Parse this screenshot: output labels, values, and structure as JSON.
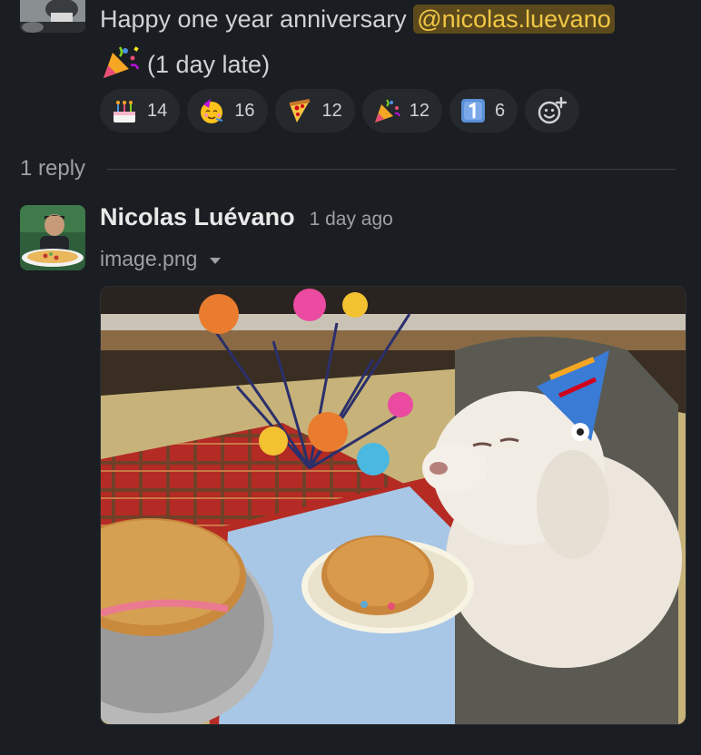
{
  "message": {
    "text_before": "Happy one year anniversary ",
    "mention": "@nicolas.luevano",
    "text_line2": "(1 day late)",
    "line2_emoji": "party-popper"
  },
  "reactions": [
    {
      "emoji": "birthday-cake",
      "count": "14"
    },
    {
      "emoji": "partying-face",
      "count": "16"
    },
    {
      "emoji": "pizza",
      "count": "12"
    },
    {
      "emoji": "party-popper",
      "count": "12"
    },
    {
      "emoji": "keycap-1",
      "count": "6"
    }
  ],
  "thread": {
    "reply_count": "1 reply"
  },
  "reply": {
    "author": "Nicolas Luévano",
    "timestamp": "1 day ago",
    "file_name": "image.png",
    "image_subject": "white poodle in a party hat at a table with birthday cookie cakes"
  },
  "colors": {
    "background": "#1a1d21",
    "mention_bg": "#5c4a1d",
    "mention_fg": "#f2c744",
    "reaction_bg": "#25282d"
  }
}
